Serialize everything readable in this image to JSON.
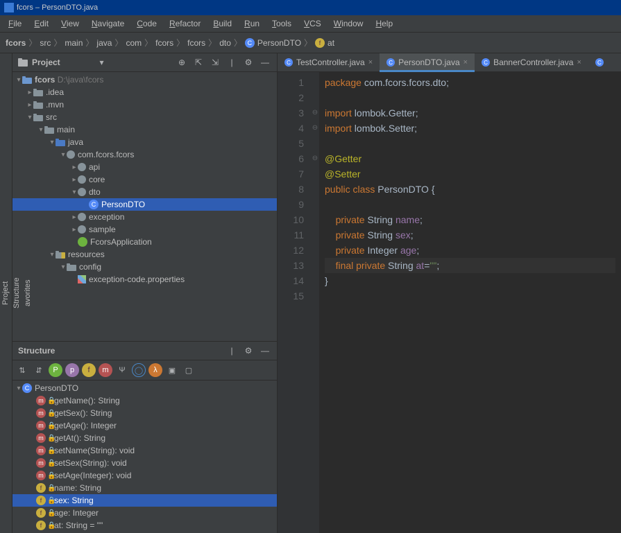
{
  "window_title": "fcors – PersonDTO.java",
  "menus": [
    "File",
    "Edit",
    "View",
    "Navigate",
    "Code",
    "Refactor",
    "Build",
    "Run",
    "Tools",
    "VCS",
    "Window",
    "Help"
  ],
  "breadcrumb": {
    "parts": [
      "fcors",
      "src",
      "main",
      "java",
      "com",
      "fcors",
      "fcors",
      "dto",
      "PersonDTO",
      "at"
    ]
  },
  "project": {
    "panel_label": "Project",
    "root_name": "fcors",
    "root_path": "D:\\java\\fcors",
    "tree": [
      {
        "indent": 1,
        "arrow": ">",
        "icon": "folder",
        "label": ".idea"
      },
      {
        "indent": 1,
        "arrow": ">",
        "icon": "folder",
        "label": ".mvn"
      },
      {
        "indent": 1,
        "arrow": "v",
        "icon": "folder",
        "label": "src"
      },
      {
        "indent": 2,
        "arrow": "v",
        "icon": "folder",
        "label": "main"
      },
      {
        "indent": 3,
        "arrow": "v",
        "icon": "folder-src",
        "label": "java"
      },
      {
        "indent": 4,
        "arrow": "v",
        "icon": "pkg",
        "label": "com.fcors.fcors"
      },
      {
        "indent": 5,
        "arrow": ">",
        "icon": "pkg",
        "label": "api"
      },
      {
        "indent": 5,
        "arrow": ">",
        "icon": "pkg",
        "label": "core"
      },
      {
        "indent": 5,
        "arrow": "v",
        "icon": "pkg",
        "label": "dto"
      },
      {
        "indent": 6,
        "arrow": "",
        "icon": "class",
        "label": "PersonDTO",
        "selected": true
      },
      {
        "indent": 5,
        "arrow": ">",
        "icon": "pkg",
        "label": "exception"
      },
      {
        "indent": 5,
        "arrow": ">",
        "icon": "pkg",
        "label": "sample"
      },
      {
        "indent": 5,
        "arrow": "",
        "icon": "spring",
        "label": "FcorsApplication"
      },
      {
        "indent": 3,
        "arrow": "v",
        "icon": "folder-res",
        "label": "resources"
      },
      {
        "indent": 4,
        "arrow": "v",
        "icon": "folder",
        "label": "config"
      },
      {
        "indent": 5,
        "arrow": "",
        "icon": "prop",
        "label": "exception-code.properties"
      }
    ]
  },
  "structure": {
    "panel_label": "Structure",
    "class_name": "PersonDTO",
    "members": [
      {
        "icon": "m",
        "label": "getName(): String"
      },
      {
        "icon": "m",
        "label": "getSex(): String"
      },
      {
        "icon": "m",
        "label": "getAge(): Integer"
      },
      {
        "icon": "m",
        "label": "getAt(): String"
      },
      {
        "icon": "m",
        "label": "setName(String): void"
      },
      {
        "icon": "m",
        "label": "setSex(String): void"
      },
      {
        "icon": "m",
        "label": "setAge(Integer): void"
      },
      {
        "icon": "f",
        "label": "name: String"
      },
      {
        "icon": "f",
        "label": "sex: String",
        "selected": true
      },
      {
        "icon": "f",
        "label": "age: Integer"
      },
      {
        "icon": "f",
        "label": "at: String = \"\""
      }
    ]
  },
  "editor": {
    "tabs": [
      {
        "label": "TestController.java",
        "active": false
      },
      {
        "label": "PersonDTO.java",
        "active": true
      },
      {
        "label": "BannerController.java",
        "active": false
      }
    ],
    "line_numbers": [
      "1",
      "2",
      "3",
      "4",
      "5",
      "6",
      "7",
      "8",
      "9",
      "10",
      "11",
      "12",
      "13",
      "14",
      "15"
    ],
    "code_lines": {
      "l1_pkg": "package",
      "l1_path": "com.fcors.fcors.dto",
      "l3_imp": "import",
      "l3_path": "lombok.Getter",
      "l4_path": "lombok.Setter",
      "l6_ann": "@Getter",
      "l7_ann": "@Setter",
      "l8_kw1": "public class",
      "l8_cls": "PersonDTO",
      "l10_kw": "private",
      "l10_type": "String",
      "l10_name": "name",
      "l11_name": "sex",
      "l12_type": "Integer",
      "l12_name": "age",
      "l13_kw1": "final private",
      "l13_type": "String",
      "l13_name": "at",
      "l13_val": "\"\""
    }
  },
  "gutters": {
    "project": "Project",
    "structure": "Structure",
    "favorites": "avorites"
  }
}
